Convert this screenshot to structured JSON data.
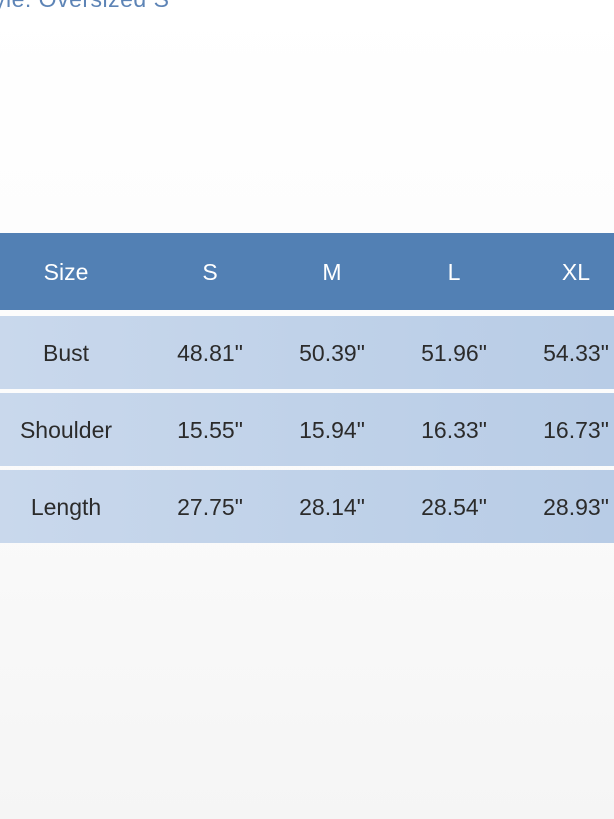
{
  "header_fragment": "yle: Oversized S",
  "size_table": {
    "columns": [
      "Size",
      "S",
      "M",
      "L",
      "XL"
    ],
    "rows": [
      {
        "label": "Bust",
        "values": [
          "48.81\"",
          "50.39\"",
          "51.96\"",
          "54.33\""
        ]
      },
      {
        "label": "Shoulder",
        "values": [
          "15.55\"",
          "15.94\"",
          "16.33\"",
          "16.73\""
        ]
      },
      {
        "label": "Length",
        "values": [
          "27.75\"",
          "28.14\"",
          "28.54\"",
          "28.93\""
        ]
      }
    ]
  },
  "colors": {
    "header_bg": "#5280b4",
    "row_bg": "#c3d4ea",
    "header_text": "#ffffff",
    "cell_text": "#2b2b2b"
  }
}
